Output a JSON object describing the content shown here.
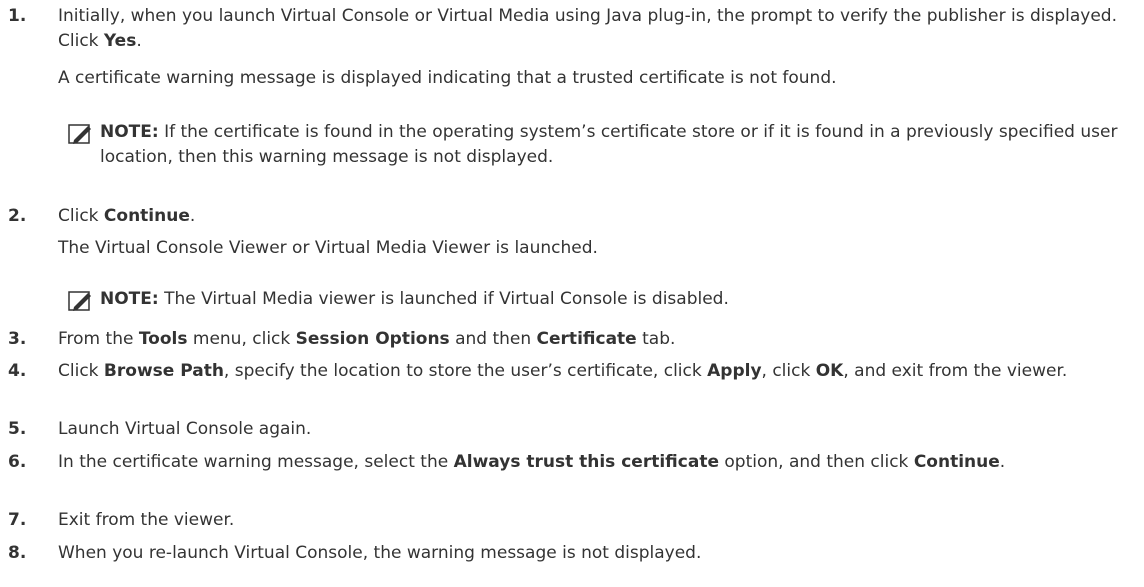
{
  "steps": [
    {
      "num": "1.",
      "parts": [
        "Initially, when you launch Virtual Console or Virtual Media using Java plug-in, the prompt to verify the publisher is displayed. Click ",
        "Yes",
        "."
      ]
    },
    {
      "num": "2.",
      "parts": [
        "Click ",
        "Continue",
        "."
      ]
    },
    {
      "num": "3.",
      "parts": [
        "From the ",
        "Tools",
        " menu, click ",
        "Session Options",
        " and then ",
        "Certificate",
        " tab."
      ]
    },
    {
      "num": "4.",
      "parts": [
        "Click ",
        "Browse Path",
        ", specify the location to store the user’s certificate, click ",
        "Apply",
        ", click ",
        "OK",
        ", and exit from the viewer."
      ]
    },
    {
      "num": "5.",
      "parts": [
        "Launch Virtual Console again."
      ]
    },
    {
      "num": "6.",
      "parts": [
        "In the certificate warning message, select the ",
        "Always trust this certificate",
        " option, and then click ",
        "Continue",
        "."
      ]
    },
    {
      "num": "7.",
      "parts": [
        "Exit from the viewer."
      ]
    },
    {
      "num": "8.",
      "parts": [
        "When you re-launch Virtual Console, the warning message is not displayed."
      ]
    }
  ],
  "sub_texts": {
    "step1_result": "A certificate warning message is displayed indicating that a trusted certificate is not found.",
    "step2_result": "The Virtual Console Viewer or Virtual Media Viewer is launched."
  },
  "notes": {
    "label": "NOTE:",
    "note1": " If the certificate is found in the operating system’s certificate store or if it is found in a previously specified user location, then this warning message is not displayed.",
    "note2": " The Virtual Media viewer is launched if Virtual Console is disabled."
  },
  "icons": {
    "note_icon": "pencil-note-icon"
  }
}
